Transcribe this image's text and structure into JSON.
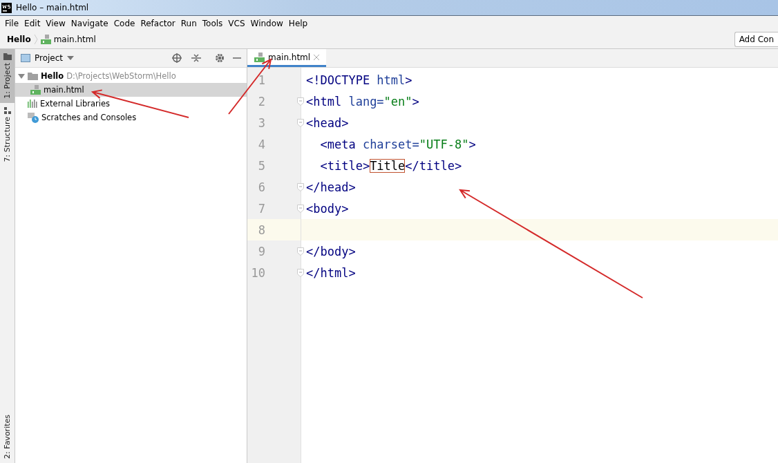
{
  "window": {
    "title": "Hello – main.html"
  },
  "menu": [
    "File",
    "Edit",
    "View",
    "Navigate",
    "Code",
    "Refactor",
    "Run",
    "Tools",
    "VCS",
    "Window",
    "Help"
  ],
  "breadcrumb": [
    {
      "label": "Hello",
      "kind": "project"
    },
    {
      "label": "main.html",
      "kind": "file"
    }
  ],
  "toolbar_button": "Add Con",
  "side_tabs": [
    {
      "label": "1: Project",
      "selected": true,
      "kind": "folder"
    },
    {
      "label": "7: Structure",
      "selected": false,
      "kind": "structure"
    }
  ],
  "bottom_side_tab": "2: Favorites",
  "project_panel": {
    "title": "Project",
    "tree": [
      {
        "label": "Hello",
        "path": "D:\\Projects\\WebStorm\\Hello",
        "kind": "folder",
        "expanded": true,
        "selected": false,
        "children": [
          {
            "label": "main.html",
            "kind": "html",
            "selected": true
          }
        ]
      },
      {
        "label": "External Libraries",
        "kind": "library",
        "selected": false
      },
      {
        "label": "Scratches and Consoles",
        "kind": "scratch",
        "selected": false
      }
    ]
  },
  "editor_tabs": [
    {
      "label": "main.html",
      "selected": true
    }
  ],
  "code_lines": [
    {
      "number": "1",
      "current": false,
      "fold": false,
      "tokens": [
        {
          "kind": "tag",
          "text": "<!DOCTYPE "
        },
        {
          "kind": "attr",
          "text": "html"
        },
        {
          "kind": "tag",
          "text": ">"
        }
      ]
    },
    {
      "number": "2",
      "current": false,
      "fold": true,
      "tokens": [
        {
          "kind": "tag",
          "text": "<html "
        },
        {
          "kind": "attr",
          "text": "lang="
        },
        {
          "kind": "string",
          "text": "\"en\""
        },
        {
          "kind": "tag",
          "text": ">"
        }
      ]
    },
    {
      "number": "3",
      "current": false,
      "fold": true,
      "tokens": [
        {
          "kind": "tag",
          "text": "<head>"
        }
      ]
    },
    {
      "number": "4",
      "current": false,
      "fold": false,
      "tokens": [
        {
          "kind": "tag",
          "text": "  <meta "
        },
        {
          "kind": "attr",
          "text": "charset="
        },
        {
          "kind": "string",
          "text": "\"UTF-8\""
        },
        {
          "kind": "tag",
          "text": ">"
        }
      ]
    },
    {
      "number": "5",
      "current": false,
      "fold": false,
      "tokens": [
        {
          "kind": "tag",
          "text": "  <title>"
        },
        {
          "kind": "boxed",
          "text": "Title"
        },
        {
          "kind": "tag",
          "text": "</title>"
        }
      ]
    },
    {
      "number": "6",
      "current": false,
      "fold": true,
      "tokens": [
        {
          "kind": "tag",
          "text": "</head>"
        }
      ]
    },
    {
      "number": "7",
      "current": false,
      "fold": true,
      "tokens": [
        {
          "kind": "tag",
          "text": "<body>"
        }
      ]
    },
    {
      "number": "8",
      "current": true,
      "fold": false
    },
    {
      "number": "9",
      "current": false,
      "fold": true,
      "tokens": [
        {
          "kind": "tag",
          "text": "</body>"
        }
      ]
    },
    {
      "number": "10",
      "current": false,
      "fold": true,
      "tokens": [
        {
          "kind": "tag",
          "text": "</html>"
        }
      ]
    }
  ]
}
